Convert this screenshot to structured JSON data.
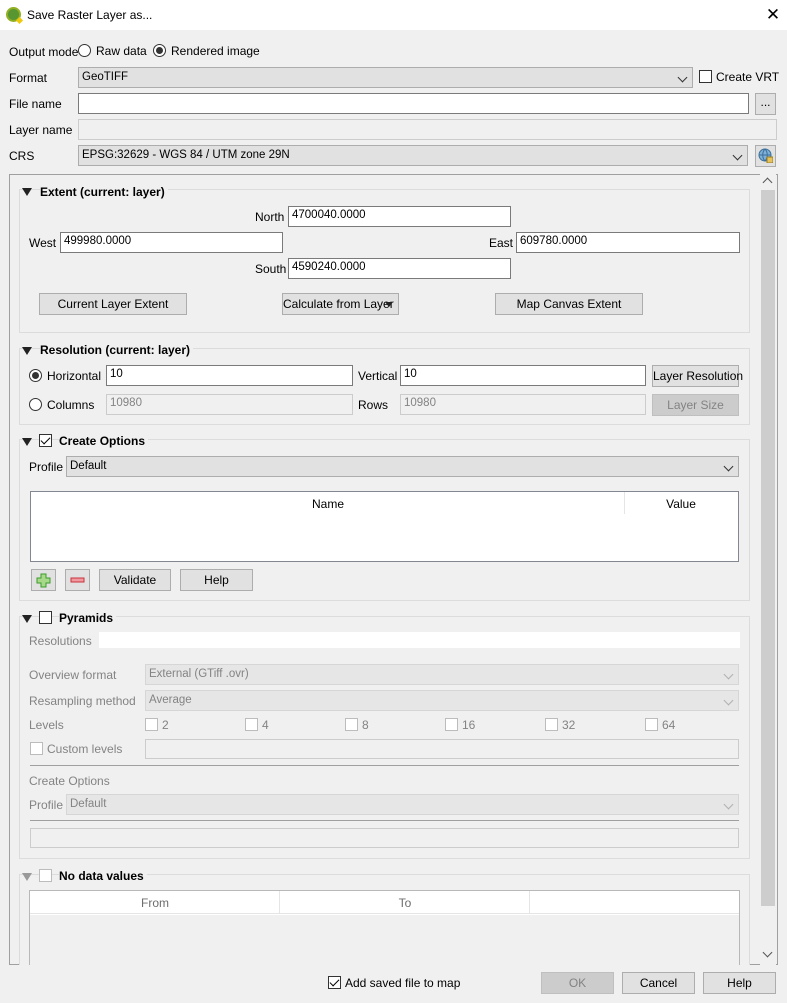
{
  "window": {
    "title": "Save Raster Layer as..."
  },
  "output_mode": {
    "label": "Output mode",
    "options": [
      "Raw data",
      "Rendered image"
    ],
    "selected": "Rendered image"
  },
  "format": {
    "label": "Format",
    "value": "GeoTIFF",
    "create_vrt_label": "Create VRT",
    "create_vrt_checked": false
  },
  "file_name": {
    "label": "File name",
    "value": "",
    "browse_label": "..."
  },
  "layer_name": {
    "label": "Layer name",
    "value": ""
  },
  "crs": {
    "label": "CRS",
    "value": "EPSG:32629 - WGS 84 / UTM zone 29N"
  },
  "extent": {
    "title": "Extent (current: layer)",
    "north_label": "North",
    "north": "4700040.0000",
    "west_label": "West",
    "west": "499980.0000",
    "east_label": "East",
    "east": "609780.0000",
    "south_label": "South",
    "south": "4590240.0000",
    "current_layer_btn": "Current Layer Extent",
    "calculate_btn": "Calculate from Layer",
    "map_canvas_btn": "Map Canvas Extent"
  },
  "resolution": {
    "title": "Resolution (current: layer)",
    "selected": "Horizontal",
    "horizontal_label": "Horizontal",
    "horizontal": "10",
    "vertical_label": "Vertical",
    "vertical": "10",
    "layer_resolution_btn": "Layer Resolution",
    "columns_label": "Columns",
    "columns": "10980",
    "rows_label": "Rows",
    "rows": "10980",
    "layer_size_btn": "Layer Size"
  },
  "create_options": {
    "title": "Create Options",
    "checked": true,
    "profile_label": "Profile",
    "profile": "Default",
    "columns": [
      "Name",
      "Value"
    ],
    "validate_btn": "Validate",
    "help_btn": "Help"
  },
  "pyramids": {
    "title": "Pyramids",
    "checked": false,
    "resolutions_label": "Resolutions",
    "overview_format_label": "Overview format",
    "overview_format": "External (GTiff .ovr)",
    "resampling_label": "Resampling method",
    "resampling": "Average",
    "levels_label": "Levels",
    "levels": [
      "2",
      "4",
      "8",
      "16",
      "32",
      "64"
    ],
    "custom_levels_label": "Custom levels",
    "create_options_label": "Create Options",
    "profile_label": "Profile",
    "profile": "Default"
  },
  "no_data": {
    "title": "No data values",
    "checked": false,
    "columns": [
      "From",
      "To",
      ""
    ]
  },
  "footer": {
    "add_to_map_label": "Add saved file to map",
    "add_to_map_checked": true,
    "ok": "OK",
    "cancel": "Cancel",
    "help": "Help"
  },
  "colors": {
    "add_green": "#3a9a2b",
    "remove_red": "#c8323c",
    "logo_green": "#589632"
  }
}
